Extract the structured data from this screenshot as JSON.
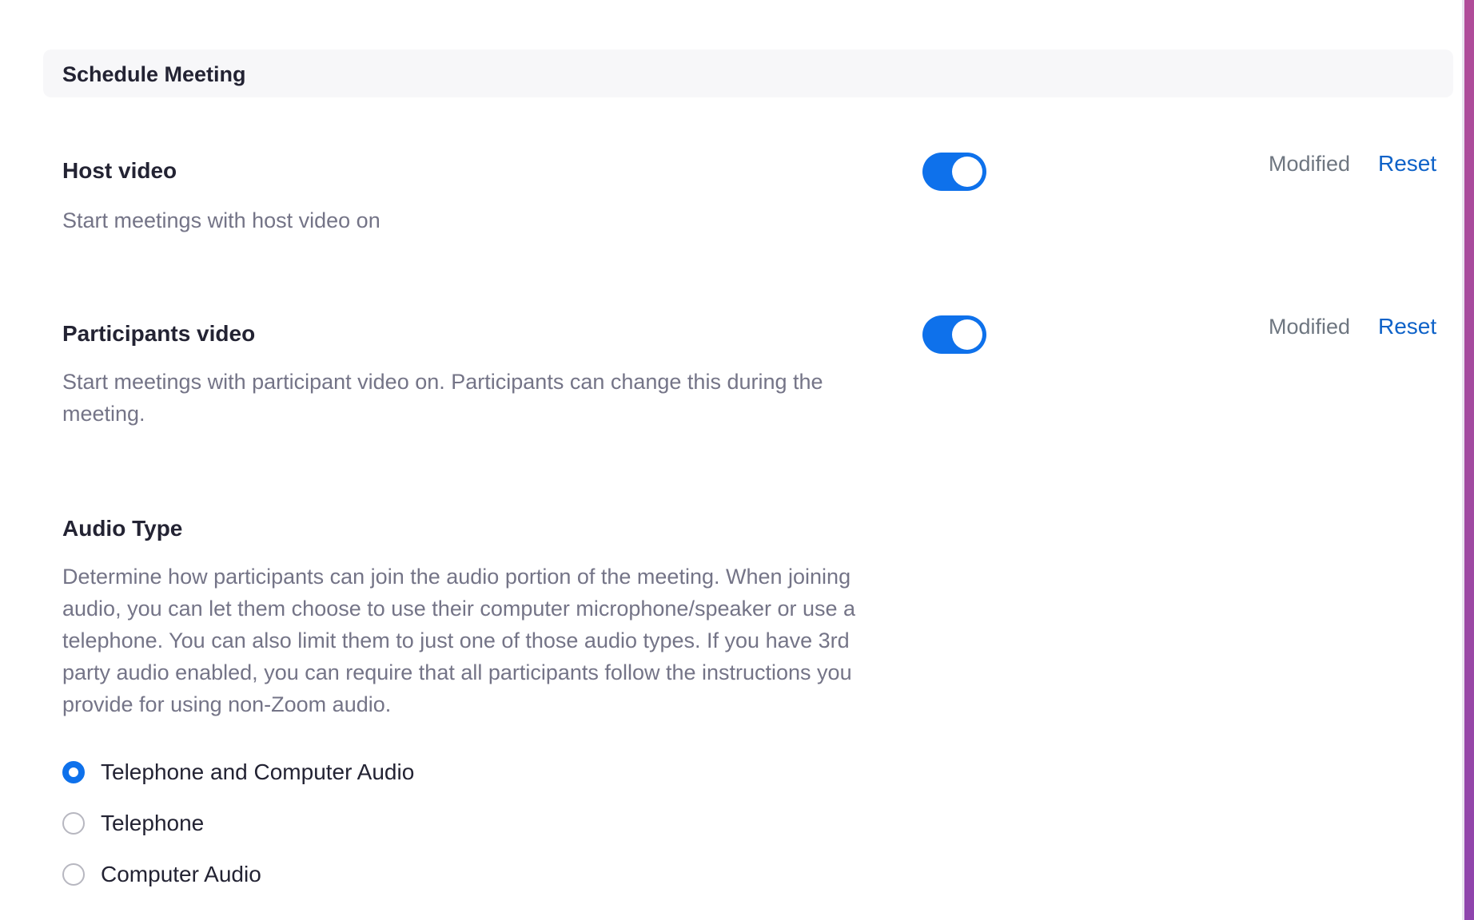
{
  "section": {
    "title": "Schedule Meeting"
  },
  "settings": {
    "host_video": {
      "title": "Host video",
      "description": "Start meetings with host video on",
      "enabled": true,
      "status": "Modified",
      "reset_label": "Reset"
    },
    "participants_video": {
      "title": "Participants video",
      "description": "Start meetings with participant video on. Participants can change this during the meeting.",
      "enabled": true,
      "status": "Modified",
      "reset_label": "Reset"
    },
    "audio_type": {
      "title": "Audio Type",
      "description": "Determine how participants can join the audio portion of the meeting. When joining audio, you can let them choose to use their computer microphone/speaker or use a telephone. You can also limit them to just one of those audio types. If you have 3rd party audio enabled, you can require that all participants follow the instructions you provide for using non-Zoom audio.",
      "options": [
        {
          "label": "Telephone and Computer Audio",
          "selected": true
        },
        {
          "label": "Telephone",
          "selected": false
        },
        {
          "label": "Computer Audio",
          "selected": false
        }
      ]
    }
  },
  "colors": {
    "accent": "#0e71eb",
    "link": "#0e62c8",
    "title_text": "#232333",
    "description_text": "#747487"
  },
  "icons": {
    "toggle": "toggle-switch",
    "radio": "radio-button"
  }
}
